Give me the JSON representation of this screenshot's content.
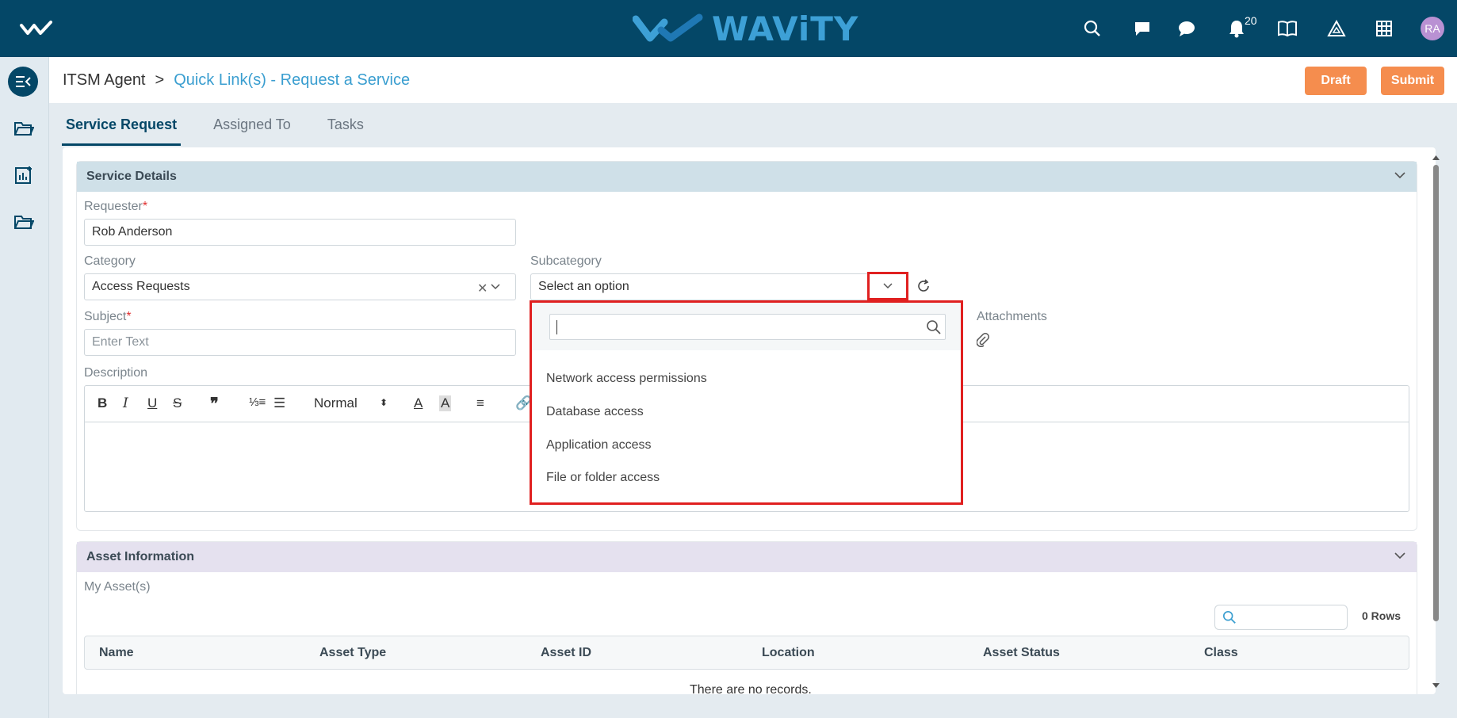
{
  "topbar": {
    "brand": "WAViTY",
    "notification_count": "20",
    "avatar_initials": "RA",
    "icons": [
      "search-icon",
      "message-icon",
      "chat-icon",
      "bell-icon",
      "book-icon",
      "warning-icon",
      "grid-icon"
    ]
  },
  "sidebar": {
    "icons": [
      "collapse-menu-icon",
      "folder-icon",
      "report-icon",
      "folder-open-icon"
    ]
  },
  "header": {
    "breadcrumb_root": "ITSM Agent",
    "breadcrumb_sep": ">",
    "breadcrumb_current": "Quick Link(s) - Request a Service",
    "draft_label": "Draft",
    "submit_label": "Submit"
  },
  "tabs": [
    "Service Request",
    "Assigned To",
    "Tasks"
  ],
  "service_details": {
    "title": "Service Details",
    "requester_label": "Requester",
    "requester_value": "Rob Anderson",
    "category_label": "Category",
    "category_value": "Access Requests",
    "subcategory_label": "Subcategory",
    "subcategory_placeholder": "Select an option",
    "subject_label": "Subject",
    "subject_placeholder": "Enter Text",
    "description_label": "Description",
    "attachments_label": "Attachments",
    "editor_format": "Normal"
  },
  "dropdown": {
    "options": [
      "Network access permissions",
      "Database access",
      "Application access",
      "File or folder access"
    ]
  },
  "asset_information": {
    "title": "Asset Information",
    "my_assets_label": "My Asset(s)",
    "rows_label": "0 Rows",
    "columns": [
      "Name",
      "Asset Type",
      "Asset ID",
      "Location",
      "Asset Status",
      "Class"
    ],
    "empty_text": "There are no records."
  },
  "colors": {
    "topbar": "#044767",
    "accent": "#3a9ed0",
    "button": "#f58d4e",
    "highlight": "#e02020"
  }
}
